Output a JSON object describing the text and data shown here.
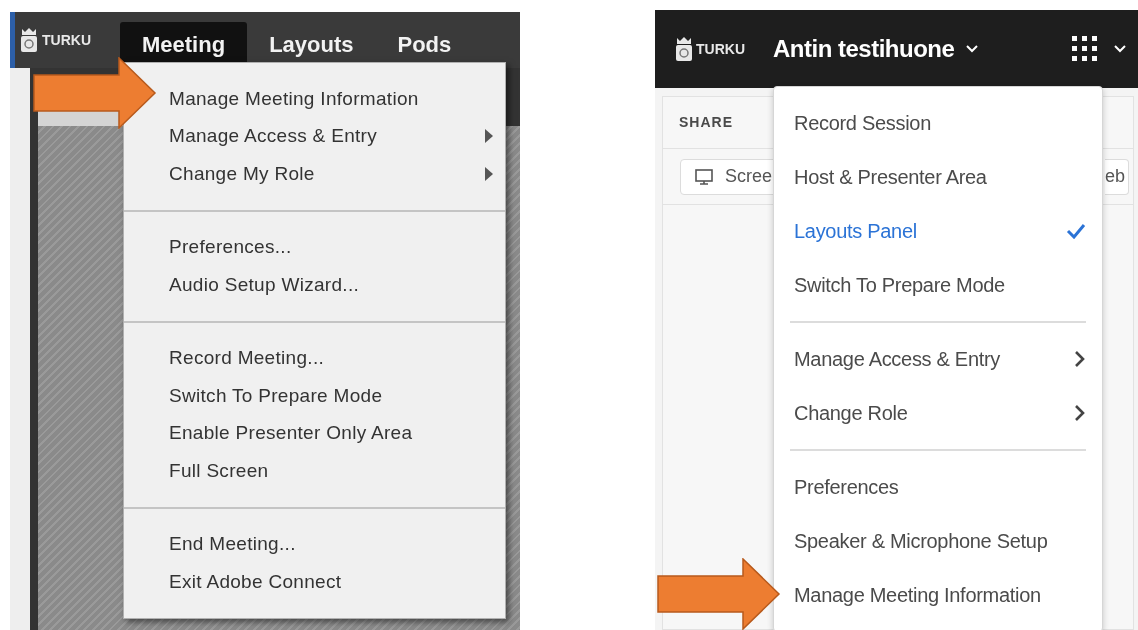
{
  "left_window": {
    "logo": "TURKU",
    "menu_bar": [
      {
        "label": "Meeting",
        "selected": true
      },
      {
        "label": "Layouts",
        "selected": false
      },
      {
        "label": "Pods",
        "selected": false
      }
    ],
    "menu": {
      "groups": [
        [
          {
            "label": "Manage Meeting Information",
            "submenu": false
          },
          {
            "label": "Manage Access & Entry",
            "submenu": true
          },
          {
            "label": "Change My Role",
            "submenu": true
          }
        ],
        [
          {
            "label": "Preferences...",
            "submenu": false
          },
          {
            "label": "Audio Setup Wizard...",
            "submenu": false
          }
        ],
        [
          {
            "label": "Record Meeting...",
            "submenu": false
          },
          {
            "label": "Switch To Prepare Mode",
            "submenu": false
          },
          {
            "label": "Enable Presenter Only Area",
            "submenu": false
          },
          {
            "label": "Full Screen",
            "submenu": false
          }
        ],
        [
          {
            "label": "End Meeting...",
            "submenu": false
          },
          {
            "label": "Exit Adobe Connect",
            "submenu": false
          }
        ]
      ]
    }
  },
  "right_window": {
    "logo": "TURKU",
    "room_title": "Antin testihuone",
    "share_label": "SHARE",
    "share_button": "Scree",
    "cut_button": "eb",
    "menu": {
      "groups": [
        [
          {
            "label": "Record Session",
            "checked": false,
            "submenu": false
          },
          {
            "label": "Host & Presenter Area",
            "checked": false,
            "submenu": false
          },
          {
            "label": "Layouts Panel",
            "checked": true,
            "submenu": false
          },
          {
            "label": "Switch To Prepare Mode",
            "checked": false,
            "submenu": false
          }
        ],
        [
          {
            "label": "Manage Access & Entry",
            "checked": false,
            "submenu": true
          },
          {
            "label": "Change Role",
            "checked": false,
            "submenu": true
          }
        ],
        [
          {
            "label": "Preferences",
            "checked": false,
            "submenu": false
          },
          {
            "label": "Speaker & Microphone Setup",
            "checked": false,
            "submenu": false
          },
          {
            "label": "Manage Meeting Information",
            "checked": false,
            "submenu": false
          }
        ]
      ]
    }
  }
}
